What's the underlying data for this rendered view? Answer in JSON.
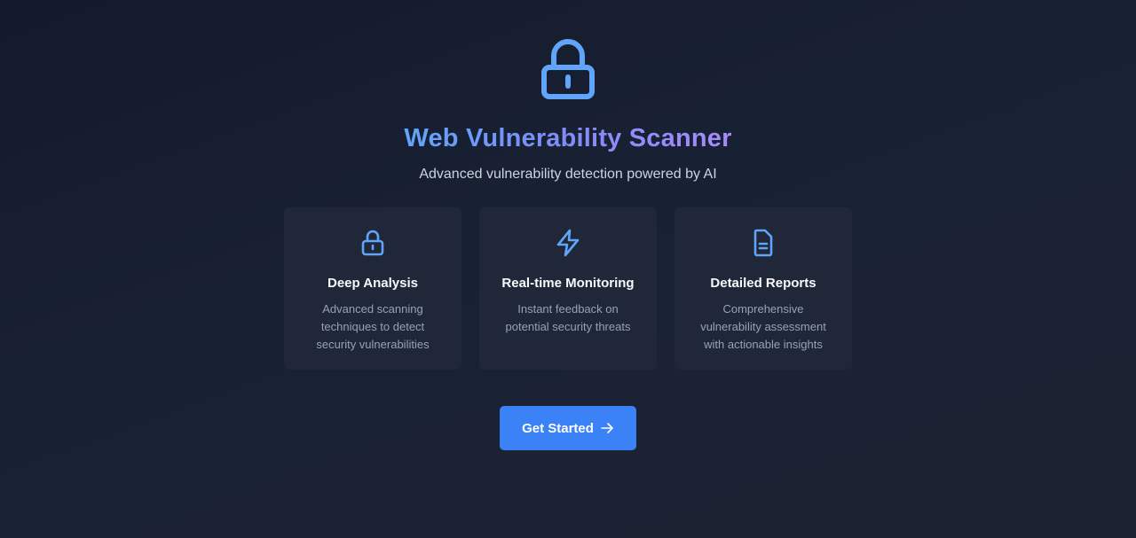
{
  "hero": {
    "icon": "lock-icon",
    "title": "Web Vulnerability Scanner",
    "subtitle": "Advanced vulnerability detection powered by AI"
  },
  "features": [
    {
      "icon": "lock-icon",
      "title": "Deep Analysis",
      "description": "Advanced scanning techniques to detect security vulnerabilities"
    },
    {
      "icon": "lightning-bolt-icon",
      "title": "Real-time Monitoring",
      "description": "Instant feedback on potential security threats"
    },
    {
      "icon": "document-icon",
      "title": "Detailed Reports",
      "description": "Comprehensive vulnerability assessment with actionable insights"
    }
  ],
  "cta": {
    "label": "Get Started",
    "icon": "arrow-right-icon"
  },
  "colors": {
    "accent": "#3b82f6",
    "icon": "#60a5fa",
    "title_gradient_start": "#60a5fa",
    "title_gradient_end": "#a78bfa",
    "card_background": "#1f2738",
    "page_background": "#182033"
  }
}
